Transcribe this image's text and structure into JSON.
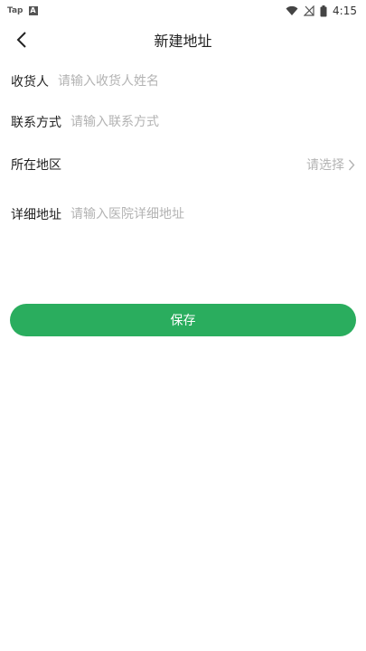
{
  "status_bar": {
    "app_label": "Tap",
    "badge_letter": "A",
    "time": "4:15"
  },
  "header": {
    "title": "新建地址"
  },
  "form": {
    "recipient": {
      "label": "收货人",
      "placeholder": "请输入收货人姓名"
    },
    "contact": {
      "label": "联系方式",
      "placeholder": "请输入联系方式"
    },
    "region": {
      "label": "所在地区",
      "select_text": "请选择"
    },
    "address": {
      "label": "详细地址",
      "placeholder": "请输入医院详细地址"
    }
  },
  "actions": {
    "save_label": "保存"
  },
  "colors": {
    "accent": "#2aad5e",
    "placeholder": "#b3b3b3"
  },
  "icons": {
    "back": "chevron-left-icon",
    "region_arrow": "chevron-right-icon",
    "wifi": "wifi-icon",
    "signal": "no-signal-icon",
    "battery": "battery-icon"
  }
}
